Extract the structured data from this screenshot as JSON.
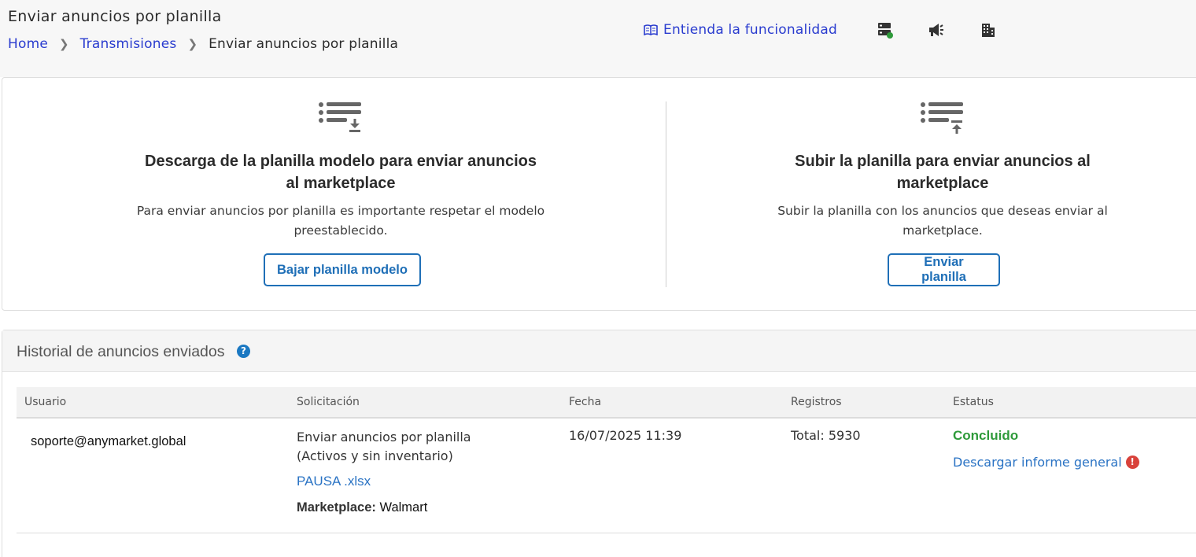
{
  "header": {
    "title": "Enviar anuncios por planilla",
    "breadcrumb": {
      "home": "Home",
      "parent": "Transmisiones",
      "current": "Enviar anuncios por planilla"
    },
    "help_link": "Entienda la funcionalidad",
    "icons": [
      "server-status-icon",
      "megaphone-icon",
      "building-icon"
    ],
    "server_status_color": "#2e9a3a"
  },
  "download_section": {
    "icon": "list-download-icon",
    "title_lines": [
      "Descarga de la planilla modelo para enviar anuncios",
      "al marketplace"
    ],
    "desc_lines": [
      "Para enviar anuncios por planilla es importante respetar el modelo",
      "preestablecido."
    ],
    "button_label": "Bajar planilla modelo"
  },
  "upload_section": {
    "icon": "list-upload-icon",
    "title_lines": [
      "Subir la planilla para enviar anuncios al",
      "marketplace"
    ],
    "desc_lines": [
      "Subir la planilla con los anuncios que deseas enviar al",
      "marketplace."
    ],
    "button_label": "Enviar planilla"
  },
  "history": {
    "title": "Historial de anuncios enviados",
    "help_icon": "?",
    "columns": [
      "Usuario",
      "Solicitación",
      "Fecha",
      "Registros",
      "Estatus"
    ],
    "rows": [
      {
        "user": "soporte@anymarket.global",
        "request_lines": [
          "Enviar anuncios por planilla",
          "(Activos y sin inventario)"
        ],
        "file": "PAUSA .xlsx",
        "marketplace_label": "Marketplace:",
        "marketplace_value": "Walmart",
        "date": "16/07/2025 11:39",
        "records": "Total: 5930",
        "status": "Concluido",
        "report_link": "Descargar informe general",
        "warn_icon": "!"
      }
    ]
  },
  "colors": {
    "accent": "#1f6fb7",
    "link": "#2a3ccf",
    "success": "#2e9a3a",
    "error": "#d9423b"
  }
}
